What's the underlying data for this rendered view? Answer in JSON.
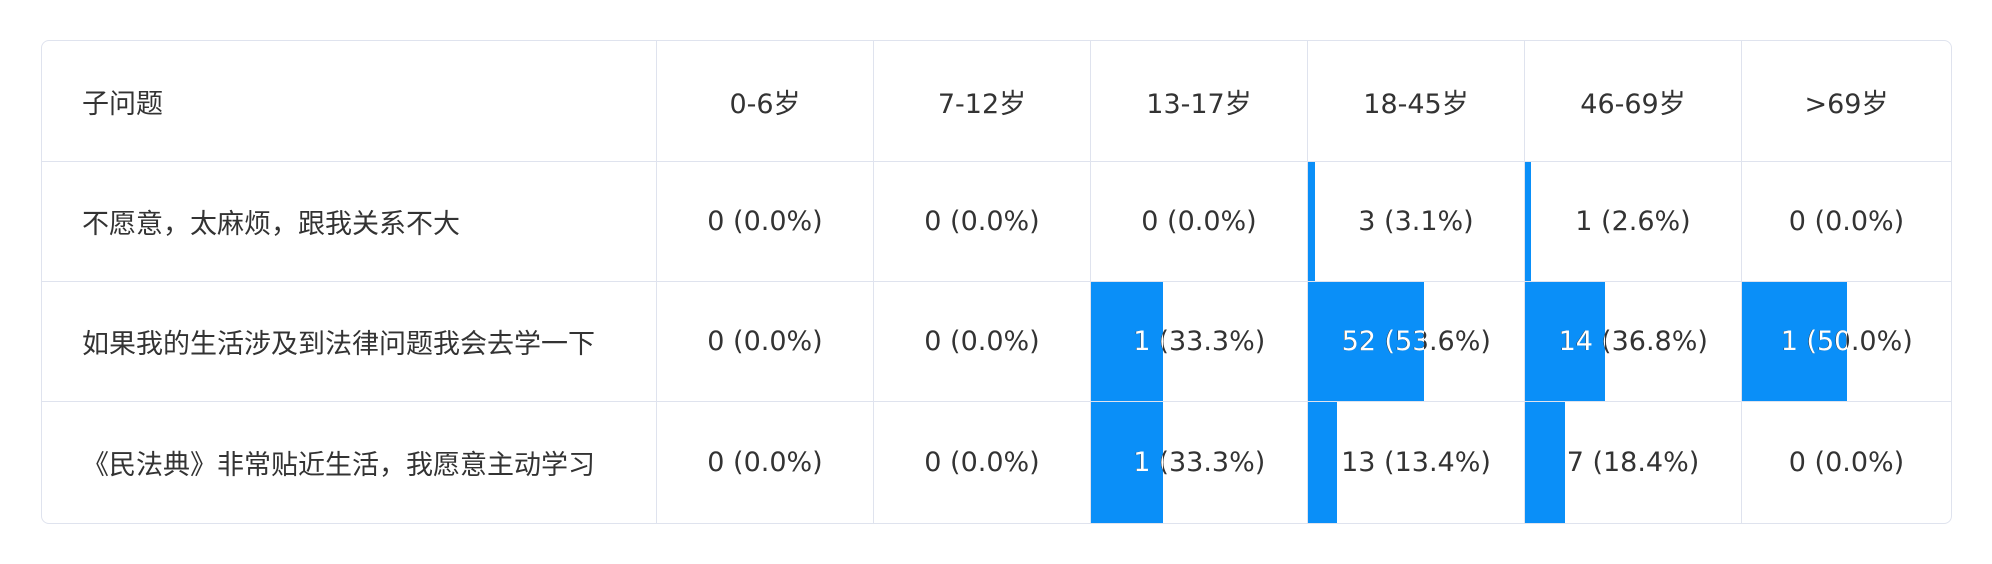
{
  "columns": [
    "子问题",
    "0-6岁",
    "7-12岁",
    "13-17岁",
    "18-45岁",
    "46-69岁",
    ">69岁"
  ],
  "rows": [
    {
      "label": "不愿意，太麻烦，跟我关系不大",
      "cells": [
        {
          "text": "0 (0.0%)",
          "percent": 0.0
        },
        {
          "text": "0 (0.0%)",
          "percent": 0.0
        },
        {
          "text": "0 (0.0%)",
          "percent": 0.0
        },
        {
          "text": "3 (3.1%)",
          "percent": 3.1
        },
        {
          "text": "1 (2.6%)",
          "percent": 2.6
        },
        {
          "text": "0 (0.0%)",
          "percent": 0.0
        }
      ]
    },
    {
      "label": "如果我的生活涉及到法律问题我会去学一下",
      "cells": [
        {
          "text": "0 (0.0%)",
          "percent": 0.0
        },
        {
          "text": "0 (0.0%)",
          "percent": 0.0
        },
        {
          "text": "1 (33.3%)",
          "percent": 33.3
        },
        {
          "text": "52 (53.6%)",
          "percent": 53.6
        },
        {
          "text": "14 (36.8%)",
          "percent": 36.8
        },
        {
          "text": "1 (50.0%)",
          "percent": 50.0
        }
      ]
    },
    {
      "label": "《民法典》非常贴近生活，我愿意主动学习",
      "cells": [
        {
          "text": "0 (0.0%)",
          "percent": 0.0
        },
        {
          "text": "0 (0.0%)",
          "percent": 0.0
        },
        {
          "text": "1 (33.3%)",
          "percent": 33.3
        },
        {
          "text": "13 (13.4%)",
          "percent": 13.4
        },
        {
          "text": "7 (18.4%)",
          "percent": 18.4
        },
        {
          "text": "0 (0.0%)",
          "percent": 0.0
        }
      ]
    }
  ],
  "colors": {
    "bar": "#0a8ff8",
    "border": "#dfe3ee",
    "text": "#333333"
  }
}
